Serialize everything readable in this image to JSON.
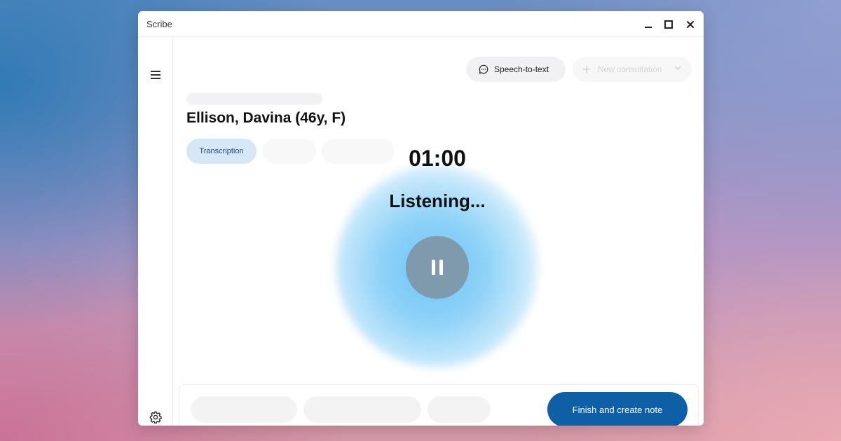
{
  "window": {
    "title": "Scribe",
    "controls": [
      "minimize-icon",
      "maximize-icon",
      "close-icon"
    ]
  },
  "sidebar": {
    "top_icon": "menu-icon",
    "bottom_icon": "gear-icon"
  },
  "header": {
    "speech_to_text_label": "Speech-to-text",
    "speech_to_text_icon": "chat-bubble-icon",
    "new_consultation_label": "New consultation",
    "new_consultation_icon": "plus-icon"
  },
  "patient": {
    "name": "Ellison, Davina (46y, F)"
  },
  "tabs": [
    {
      "label": "Transcription",
      "active": true
    }
  ],
  "recording": {
    "timer": "01:00",
    "status": "Listening...",
    "pause_icon": "pause-icon"
  },
  "footer": {
    "finish_label": "Finish and create note"
  },
  "colors": {
    "accent": "#0f5fa7",
    "tab_active_bg": "#d6e7f8",
    "pause_bg": "#7f99ad",
    "glow": "#6fc4f7"
  }
}
